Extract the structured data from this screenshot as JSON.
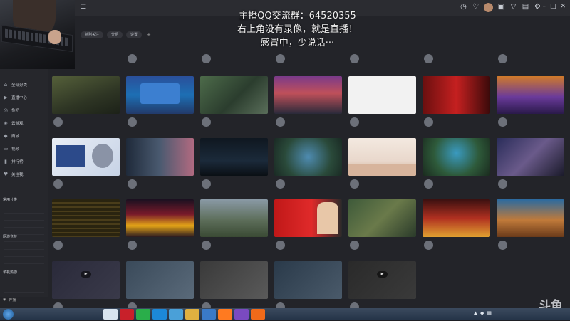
{
  "overlay": {
    "line1": "主播QQ交流群：64520355",
    "line2": "右上角没有录像，就是直播！",
    "line3": "感冒中，少说话···"
  },
  "topbar": {
    "menu_icon": "menu-icon",
    "tools": [
      "clock-icon",
      "heart-icon",
      "avatar",
      "gift-icon",
      "shirt-icon",
      "box-icon",
      "gear-icon"
    ],
    "window_controls": [
      "minimize-icon",
      "maximize-icon",
      "close-icon"
    ]
  },
  "sidebar": {
    "items": [
      {
        "icon": "home-icon",
        "label": "全部分类"
      },
      {
        "icon": "live-icon",
        "label": "直播中心"
      },
      {
        "icon": "fish-icon",
        "label": "鱼吧"
      },
      {
        "icon": "game-icon",
        "label": "云游戏"
      },
      {
        "icon": "cart-icon",
        "label": "商城"
      },
      {
        "icon": "video-icon",
        "label": "视频"
      },
      {
        "icon": "rank-icon",
        "label": "排行榜"
      },
      {
        "icon": "follow-icon",
        "label": "关注我"
      }
    ],
    "sections": [
      "常用分类",
      "网游竞技",
      "单机热游"
    ],
    "bottom_label": "开播"
  },
  "filters": {
    "chips": [
      "特别关注",
      "分组",
      "设置"
    ],
    "add": "+"
  },
  "colors": {
    "background": "#232429",
    "accent": "#ff6a00",
    "taskbar": "#2c3b50"
  },
  "watermark": "斗鱼",
  "taskbar": {
    "start_icon": "windows-start-icon",
    "apps": [
      "app-icon",
      "netease-icon",
      "wechat-icon",
      "qq-icon",
      "chat-icon",
      "folder-icon",
      "cloud-icon",
      "douyu-icon",
      "game-icon",
      "douyu-app-icon"
    ]
  }
}
